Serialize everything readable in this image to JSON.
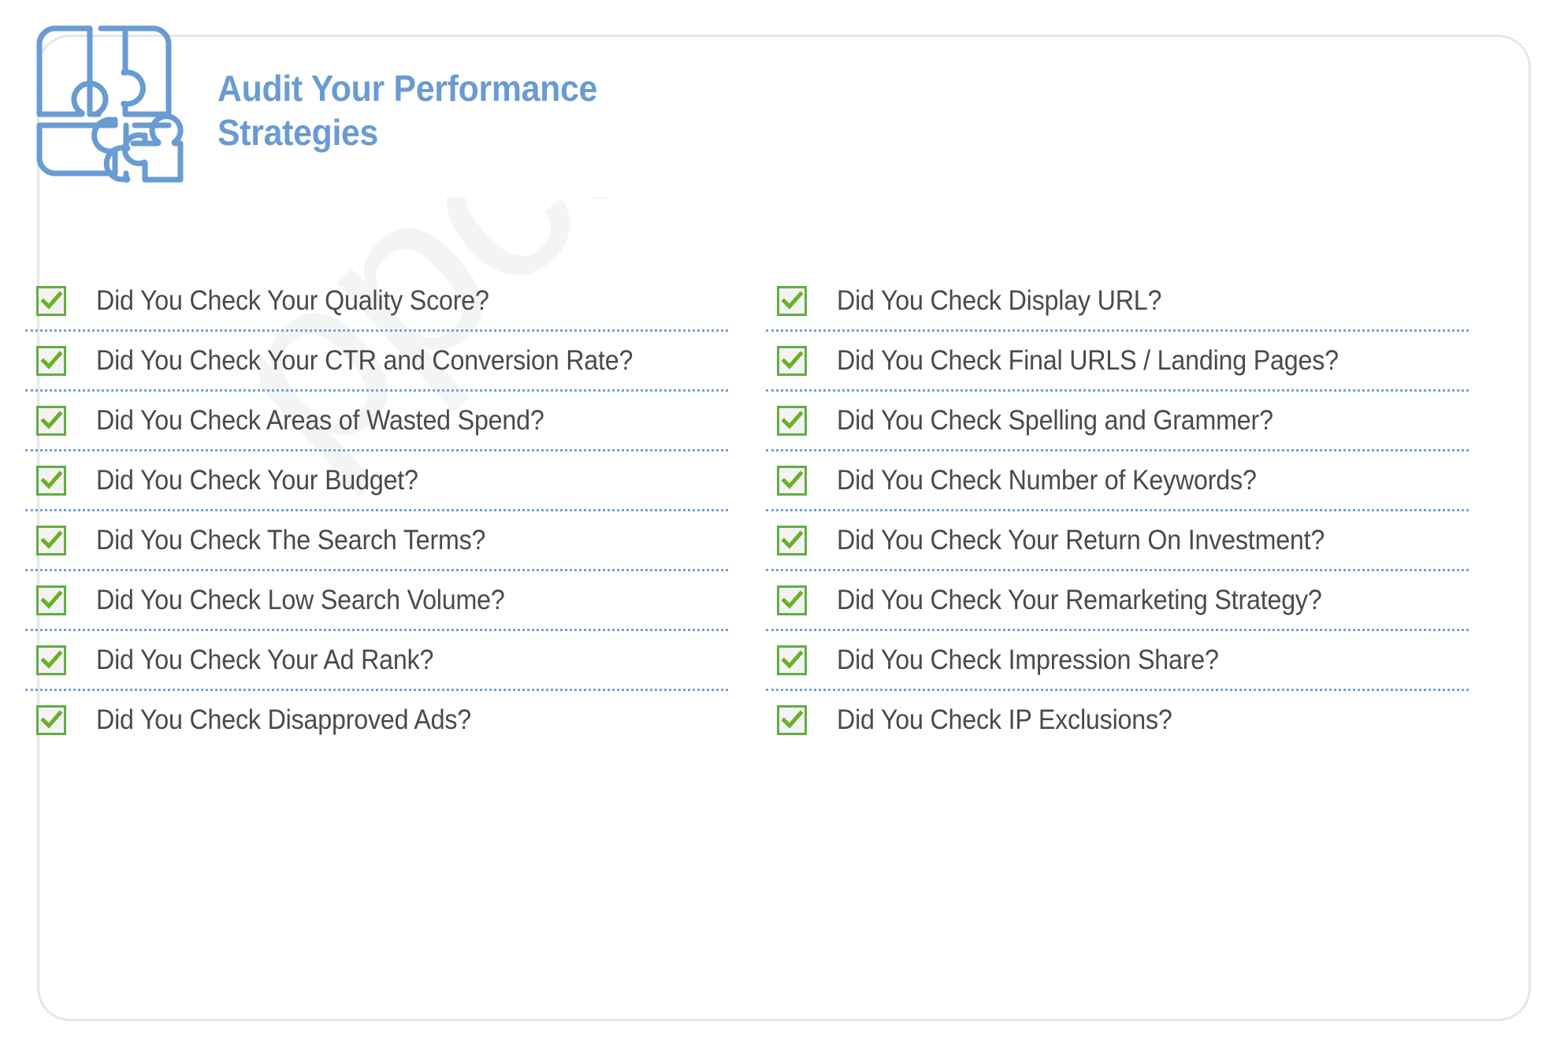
{
  "card": {
    "border_color": "#e6e6e6",
    "background": "#ffffff"
  },
  "watermark": {
    "text": "ppcexpo",
    "color": "#f4f4f4"
  },
  "header": {
    "icon": "puzzle-pieces-icon",
    "icon_color": "#6a9bd2",
    "title": "Audit Your Performance\nStrategies",
    "title_color": "#6a9bd2"
  },
  "checklist": {
    "checkbox_border_color": "#63ac45",
    "checkbox_fill_color": "#f3f3f3",
    "check_color": "#6ab023",
    "separator_color": "#7b9fd4",
    "label_color": "#4a4a4a",
    "left_column": [
      {
        "checked": true,
        "label": "Did You Check Your Quality Score?"
      },
      {
        "checked": true,
        "label": "Did You Check Your CTR and Conversion Rate?"
      },
      {
        "checked": true,
        "label": "Did You Check Areas of Wasted Spend?"
      },
      {
        "checked": true,
        "label": "Did You Check Your Budget?"
      },
      {
        "checked": true,
        "label": "Did You Check The Search Terms?"
      },
      {
        "checked": true,
        "label": "Did You Check Low Search Volume?"
      },
      {
        "checked": true,
        "label": "Did You Check Your Ad Rank?"
      },
      {
        "checked": true,
        "label": "Did You Check Disapproved Ads?"
      }
    ],
    "right_column": [
      {
        "checked": true,
        "label": "Did You Check Display URL?"
      },
      {
        "checked": true,
        "label": "Did You Check Final URLS / Landing Pages?"
      },
      {
        "checked": true,
        "label": "Did You Check Spelling and Grammer?"
      },
      {
        "checked": true,
        "label": "Did You Check Number of Keywords?"
      },
      {
        "checked": true,
        "label": "Did You Check Your Return On Investment?"
      },
      {
        "checked": true,
        "label": "Did You Check Your Remarketing Strategy?"
      },
      {
        "checked": true,
        "label": "Did You Check Impression Share?"
      },
      {
        "checked": true,
        "label": "Did You Check IP Exclusions?"
      }
    ]
  }
}
